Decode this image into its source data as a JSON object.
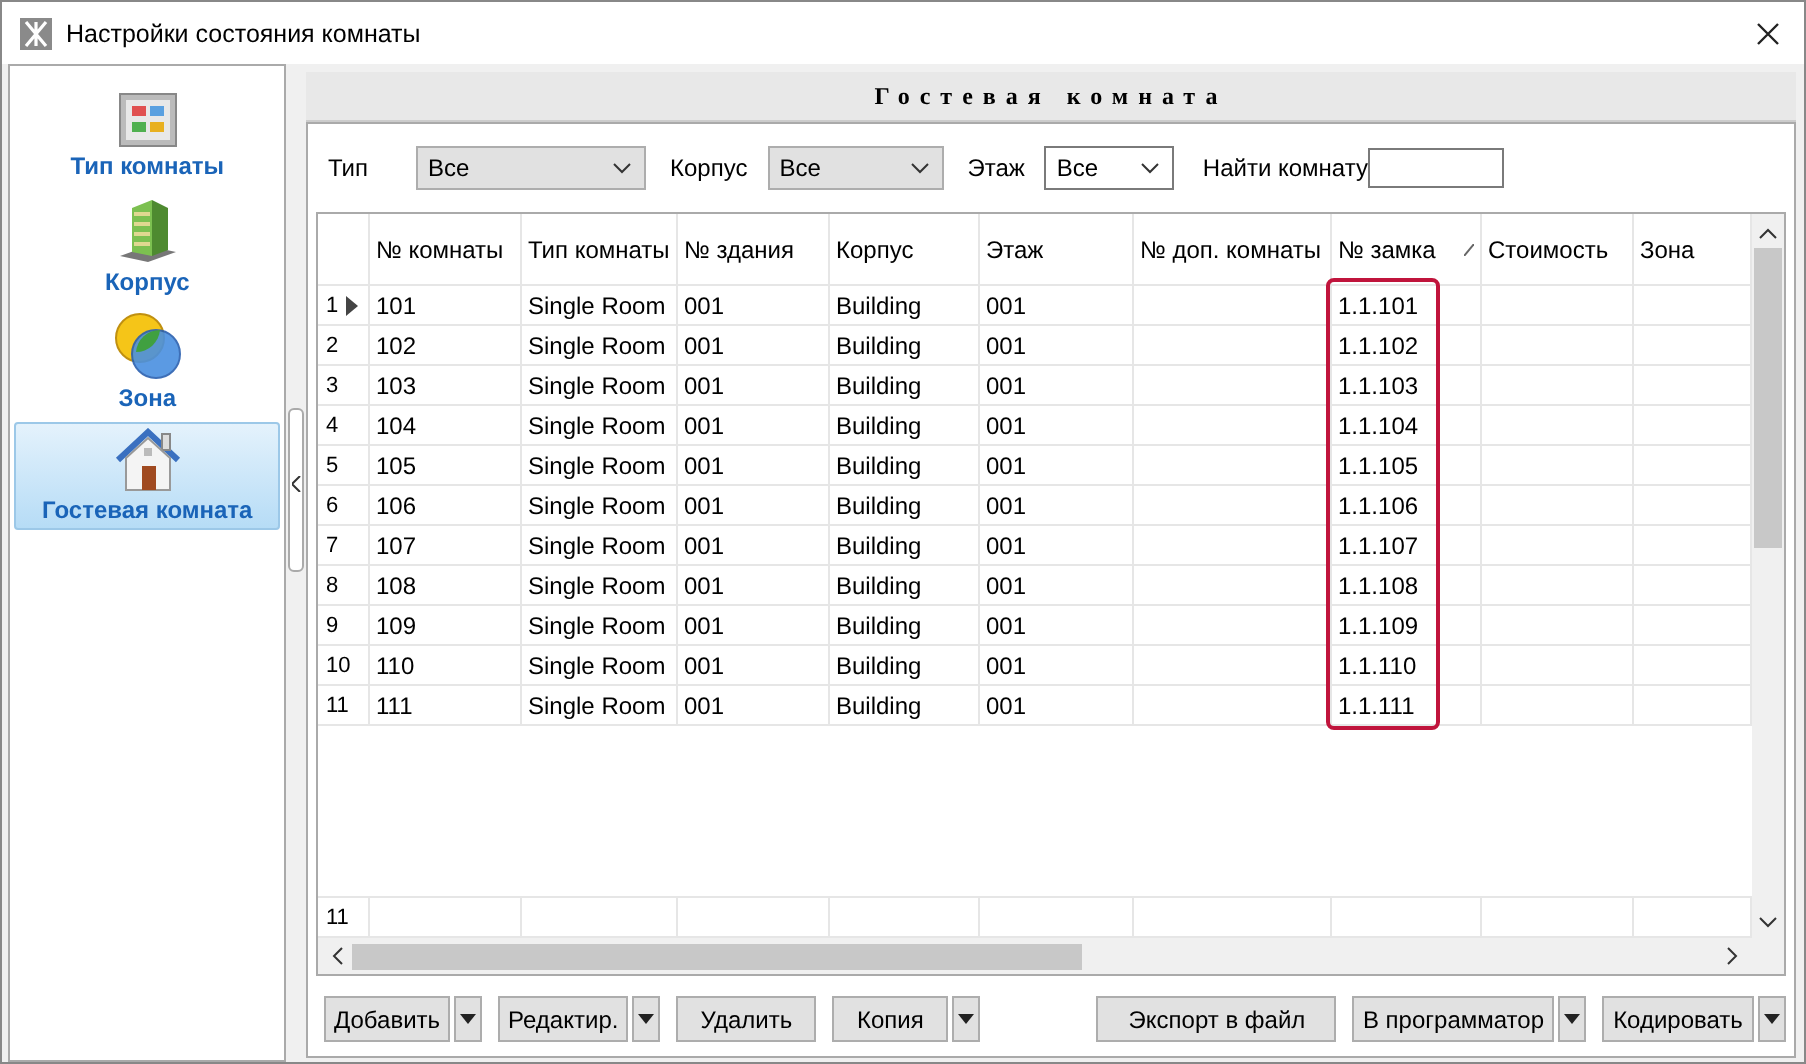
{
  "window": {
    "title": "Настройки состояния комнаты"
  },
  "sidebar": {
    "items": [
      {
        "kind": "room-type",
        "label": "Тип комнаты",
        "selected": false
      },
      {
        "kind": "building",
        "label": "Корпус",
        "selected": false
      },
      {
        "kind": "zone",
        "label": "Зона",
        "selected": false
      },
      {
        "kind": "room",
        "label": "Гостевая комната",
        "selected": true
      }
    ]
  },
  "panel": {
    "title": "Гостевая комната"
  },
  "filters": [
    {
      "kind": "select",
      "label": "Тип",
      "value": "Все"
    },
    {
      "kind": "select",
      "label": "Корпус",
      "value": "Все"
    },
    {
      "kind": "select",
      "label": "Этаж",
      "value": "Все"
    },
    {
      "kind": "search",
      "label": "Найти комнату"
    }
  ],
  "table": {
    "columns": [
      "№ комнаты",
      "Тип комнаты",
      "№ здания",
      "Корпус",
      "Этаж",
      "№ доп. комнаты",
      "№ замка",
      "Стоимость",
      "Зона"
    ],
    "rows": [
      {
        "index": "1",
        "selected": true,
        "cells": [
          "101",
          "Single Room",
          "001",
          "Building",
          "001",
          "",
          "1.1.101",
          "",
          ""
        ]
      },
      {
        "index": "2",
        "selected": false,
        "cells": [
          "102",
          "Single Room",
          "001",
          "Building",
          "001",
          "",
          "1.1.102",
          "",
          ""
        ]
      },
      {
        "index": "3",
        "selected": false,
        "cells": [
          "103",
          "Single Room",
          "001",
          "Building",
          "001",
          "",
          "1.1.103",
          "",
          ""
        ]
      },
      {
        "index": "4",
        "selected": false,
        "cells": [
          "104",
          "Single Room",
          "001",
          "Building",
          "001",
          "",
          "1.1.104",
          "",
          ""
        ]
      },
      {
        "index": "5",
        "selected": false,
        "cells": [
          "105",
          "Single Room",
          "001",
          "Building",
          "001",
          "",
          "1.1.105",
          "",
          ""
        ]
      },
      {
        "index": "6",
        "selected": false,
        "cells": [
          "106",
          "Single Room",
          "001",
          "Building",
          "001",
          "",
          "1.1.106",
          "",
          ""
        ]
      },
      {
        "index": "7",
        "selected": false,
        "cells": [
          "107",
          "Single Room",
          "001",
          "Building",
          "001",
          "",
          "1.1.107",
          "",
          ""
        ]
      },
      {
        "index": "8",
        "selected": false,
        "cells": [
          "108",
          "Single Room",
          "001",
          "Building",
          "001",
          "",
          "1.1.108",
          "",
          ""
        ]
      },
      {
        "index": "9",
        "selected": false,
        "cells": [
          "109",
          "Single Room",
          "001",
          "Building",
          "001",
          "",
          "1.1.109",
          "",
          ""
        ]
      },
      {
        "index": "10",
        "selected": false,
        "cells": [
          "110",
          "Single Room",
          "001",
          "Building",
          "001",
          "",
          "1.1.110",
          "",
          ""
        ]
      },
      {
        "index": "11",
        "selected": false,
        "cells": [
          "111",
          "Single Room",
          "001",
          "Building",
          "001",
          "",
          "1.1.111",
          "",
          ""
        ]
      }
    ],
    "footer_count": "11"
  },
  "buttons": [
    {
      "label": "Добавить",
      "has_menu": true
    },
    {
      "label": "Редактир.",
      "has_menu": true
    },
    {
      "label": "Удалить",
      "has_menu": false
    },
    {
      "label": "Копия",
      "has_menu": true
    },
    {
      "label": "Экспорт в файл",
      "has_menu": false
    },
    {
      "label": "В программатор",
      "has_menu": true
    },
    {
      "label": "Кодировать",
      "has_menu": true
    }
  ]
}
